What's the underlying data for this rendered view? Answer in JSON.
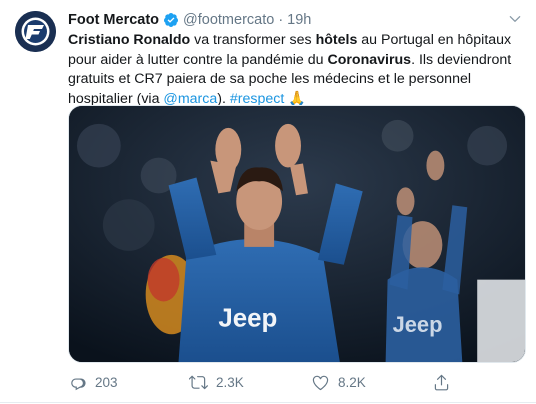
{
  "tweet": {
    "author_name": "Foot Mercato",
    "handle": "@footmercato",
    "separator": "·",
    "time": "19h",
    "text_parts": {
      "p1": "Cristiano Ronaldo",
      "p2": " va transformer ses ",
      "p3": "hôtels",
      "p4": " au Portugal en hôpitaux pour aider à lutter contre la pandémie du ",
      "p5": "Coronavirus",
      "p6": ". Ils deviendront gratuits et CR7 paiera de sa poche les médecins et le personnel hospitalier (via ",
      "p7": "@marca",
      "p8": "). ",
      "p9": "#respect",
      "p10": " 🙏"
    },
    "media": {
      "jersey_brand_1": "Jeep",
      "jersey_brand_2": "Jeep"
    },
    "actions": {
      "reply_count": "203",
      "retweet_count": "2.3K",
      "like_count": "8.2K"
    }
  },
  "colors": {
    "link": "#1b95e0",
    "verified": "#1da1f2",
    "secondary_text": "#657786"
  },
  "icons": {
    "avatar": "foot-mercato-logo",
    "verified": "verified-badge-icon",
    "menu": "chevron-down-icon",
    "reply": "reply-icon",
    "retweet": "retweet-icon",
    "like": "heart-icon",
    "share": "share-icon"
  }
}
